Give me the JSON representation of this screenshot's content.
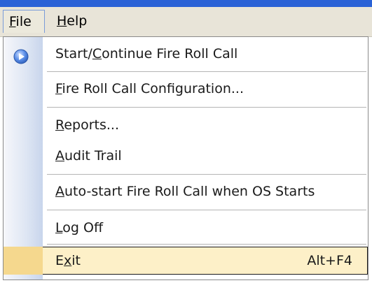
{
  "menubar": {
    "file": {
      "pre": "",
      "mn": "F",
      "post": "ile"
    },
    "help": {
      "pre": "",
      "mn": "H",
      "post": "elp"
    }
  },
  "menu": {
    "items": [
      {
        "pre": "Start/",
        "mn": "C",
        "post": "ontinue Fire Roll Call",
        "icon": "play-circle-icon"
      },
      {
        "pre": "",
        "mn": "F",
        "post": "ire Roll Call Configuration..."
      },
      {
        "pre": "",
        "mn": "R",
        "post": "eports..."
      },
      {
        "pre": "",
        "mn": "A",
        "post": "udit Trail"
      },
      {
        "pre": "",
        "mn": "A",
        "post": "uto-start Fire Roll Call when OS Starts"
      },
      {
        "pre": "",
        "mn": "L",
        "post": "og Off"
      },
      {
        "pre": "E",
        "mn": "x",
        "post": "it",
        "shortcut": "Alt+F4",
        "highlighted": true
      }
    ]
  },
  "colors": {
    "highlight_bg": "#fdf0c8",
    "icon_blue": "#4a7cd6"
  }
}
